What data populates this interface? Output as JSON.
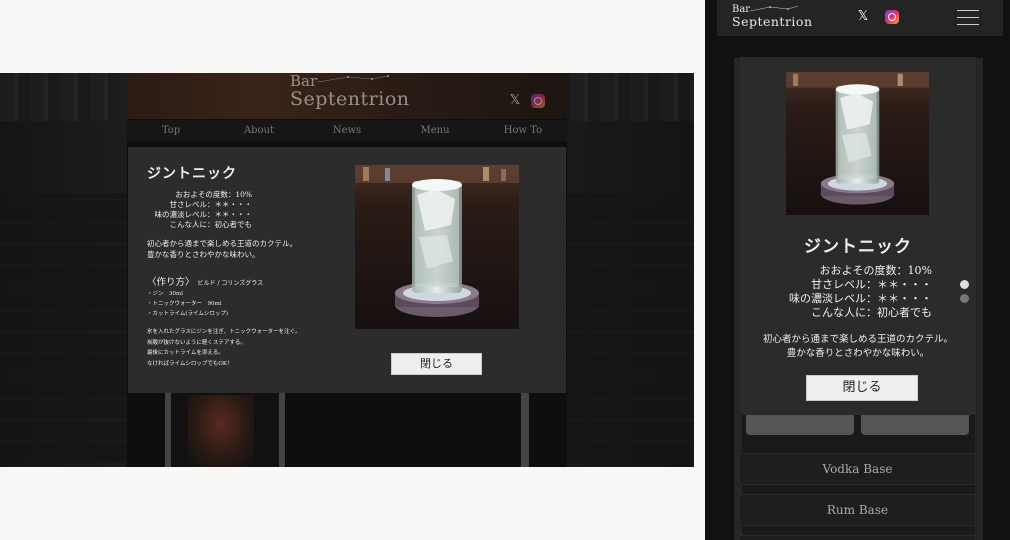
{
  "brand": {
    "line1": "Bar",
    "line2": "Septentrion"
  },
  "social": {
    "x_label": "𝕏"
  },
  "nav": [
    "Top",
    "About",
    "News",
    "Menu",
    "How To"
  ],
  "cocktail": {
    "name": "ジントニック",
    "stats": [
      "おおよその度数：10%",
      "甘さレベル：＊＊・・・",
      "味の濃淡レベル：＊＊・・・",
      "こんな人に：初心者でも"
    ],
    "description": [
      "初心者から通まで楽しめる王道のカクテル。",
      "豊かな香りとさわやかな味わい。"
    ],
    "howto_title": "〈作り方〉",
    "howto_sub": "ビルド / コリンズグラス",
    "ingredients": [
      "・ジン　30ml",
      "・トニックウォーター　90ml",
      "・カットライム(ライムシロップ)"
    ],
    "steps": [
      "氷を入れたグラスにジンを注ぎ、トニックウォーターを注ぐ。",
      "炭酸が抜けないように軽くステアする。",
      "最後にカットライムを添える。",
      "なければライムシロップでもOK！"
    ],
    "close_label": "閉じる"
  },
  "mobile": {
    "list": [
      "Vodka Base",
      "Rum Base"
    ]
  },
  "colors": {
    "modal_bg": "#2c2c2c",
    "button_bg": "#eeeeee",
    "page_bg": "#111111"
  }
}
